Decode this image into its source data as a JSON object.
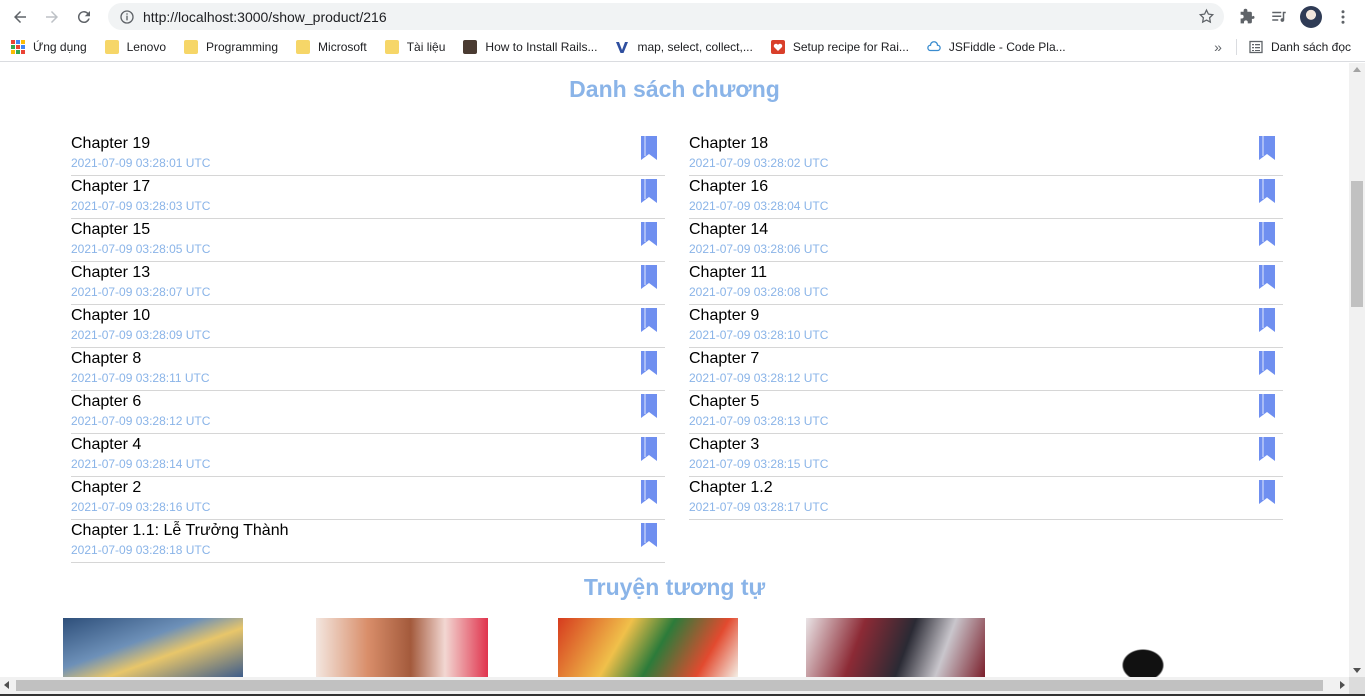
{
  "browser": {
    "url": "http://localhost:3000/show_product/216"
  },
  "bookmarks": {
    "items": [
      {
        "label": "Ứng dụng",
        "icon": "apps-grid-icon"
      },
      {
        "label": "Lenovo",
        "icon": "folder-icon"
      },
      {
        "label": "Programming",
        "icon": "folder-icon"
      },
      {
        "label": "Microsoft",
        "icon": "folder-icon"
      },
      {
        "label": "Tài liệu",
        "icon": "folder-icon"
      },
      {
        "label": "How to Install Rails...",
        "icon": "site-favicon"
      },
      {
        "label": "map, select, collect,...",
        "icon": "v-favicon"
      },
      {
        "label": "Setup recipe for Rai...",
        "icon": "recipe-favicon"
      },
      {
        "label": "JSFiddle - Code Pla...",
        "icon": "jsfiddle-favicon"
      }
    ],
    "more": "»",
    "reading_list": "Danh sách đọc"
  },
  "chapter_section": {
    "title": "Danh sách chương",
    "chapters": [
      {
        "name": "Chapter 19",
        "date": "2021-07-09 03:28:01 UTC"
      },
      {
        "name": "Chapter 18",
        "date": "2021-07-09 03:28:02 UTC"
      },
      {
        "name": "Chapter 17",
        "date": "2021-07-09 03:28:03 UTC"
      },
      {
        "name": "Chapter 16",
        "date": "2021-07-09 03:28:04 UTC"
      },
      {
        "name": "Chapter 15",
        "date": "2021-07-09 03:28:05 UTC"
      },
      {
        "name": "Chapter 14",
        "date": "2021-07-09 03:28:06 UTC"
      },
      {
        "name": "Chapter 13",
        "date": "2021-07-09 03:28:07 UTC"
      },
      {
        "name": "Chapter 11",
        "date": "2021-07-09 03:28:08 UTC"
      },
      {
        "name": "Chapter 10",
        "date": "2021-07-09 03:28:09 UTC"
      },
      {
        "name": "Chapter 9",
        "date": "2021-07-09 03:28:10 UTC"
      },
      {
        "name": "Chapter 8",
        "date": "2021-07-09 03:28:11 UTC"
      },
      {
        "name": "Chapter 7",
        "date": "2021-07-09 03:28:12 UTC"
      },
      {
        "name": "Chapter 6",
        "date": "2021-07-09 03:28:12 UTC"
      },
      {
        "name": "Chapter 5",
        "date": "2021-07-09 03:28:13 UTC"
      },
      {
        "name": "Chapter 4",
        "date": "2021-07-09 03:28:14 UTC"
      },
      {
        "name": "Chapter 3",
        "date": "2021-07-09 03:28:15 UTC"
      },
      {
        "name": "Chapter 2",
        "date": "2021-07-09 03:28:16 UTC"
      },
      {
        "name": "Chapter 1.2",
        "date": "2021-07-09 03:28:17 UTC"
      },
      {
        "name": "Chapter 1.1: Lễ Trưởng Thành",
        "date": "2021-07-09 03:28:18 UTC"
      }
    ]
  },
  "related_section": {
    "title": "Truyện tương tự"
  },
  "colors": {
    "accent": "#8ab4e8",
    "bookmark": "#6f8ff0"
  }
}
